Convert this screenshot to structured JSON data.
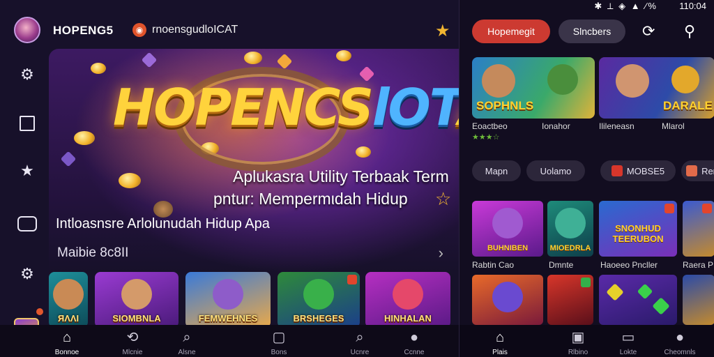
{
  "left": {
    "brand": "HOPENG5",
    "url_text": "rnoensgudloICAT",
    "hero": {
      "logo_gold": "HOPENCS",
      "logo_blue": "lOT",
      "logo_tail": "A",
      "line1": "Aplukasra Utility Terbaak Term",
      "line2": "pntur: Mempermιdah Hidup",
      "line3": "Intloasnsre Arlolunudah Hidup Apa"
    },
    "section_title": "Maibie 8c8IΙ",
    "games": [
      {
        "title": "ЯΛΛΙ"
      },
      {
        "title": "SIOMBNLA"
      },
      {
        "title": "FEMWEHNES"
      },
      {
        "title": "BRSHEGES"
      },
      {
        "title": "HINHALAN"
      }
    ],
    "tabs": [
      {
        "icon": "⌂",
        "label": "Bonnoe"
      },
      {
        "icon": "⟲",
        "label": "Mlcnie"
      },
      {
        "icon": "⌕",
        "label": "Alsne"
      },
      {
        "icon": "▢",
        "label": "Bons"
      },
      {
        "icon": "⌕",
        "label": "Ucnre"
      },
      {
        "icon": "●",
        "label": "Ccnne"
      }
    ]
  },
  "right": {
    "status_icons": "✱ ⟂ ◈ ▲ ∕%",
    "time": "110:04",
    "pill_red": "Hopemegit",
    "pill_grey": "Slncbers",
    "featured": [
      {
        "title": "SOPHNLS",
        "caption": "Eoactbeo"
      },
      {
        "title": "",
        "caption": "Ionahor"
      },
      {
        "title": "",
        "caption": "Ilileneasn"
      },
      {
        "title": "DARALE",
        "caption": "Mlarol"
      }
    ],
    "stars": "★★★☆",
    "chips": [
      {
        "label": "Mapn"
      },
      {
        "label": "Uolamo"
      },
      {
        "label": "MOBSE5"
      },
      {
        "label": "Ren"
      }
    ],
    "tiles": [
      {
        "title": "BUHNIBEN",
        "caption": "Rabtin Cao"
      },
      {
        "title": "MIOEDRLA",
        "caption": "Dmnte"
      },
      {
        "title": "SNONHUD TEERUBON",
        "caption": "Haoeeo Pncller"
      },
      {
        "title": "",
        "caption": "Raera P"
      }
    ],
    "tabs": [
      {
        "icon": "⌂",
        "label": "Plais"
      },
      {
        "icon": "▣",
        "label": "Rlbino"
      },
      {
        "icon": "▭",
        "label": "Lokte"
      },
      {
        "icon": "●",
        "label": "Cheomnls"
      }
    ]
  },
  "colors": {
    "accent_red": "#cc3a31",
    "gold": "#ffd33c",
    "bg": "#17112a"
  }
}
